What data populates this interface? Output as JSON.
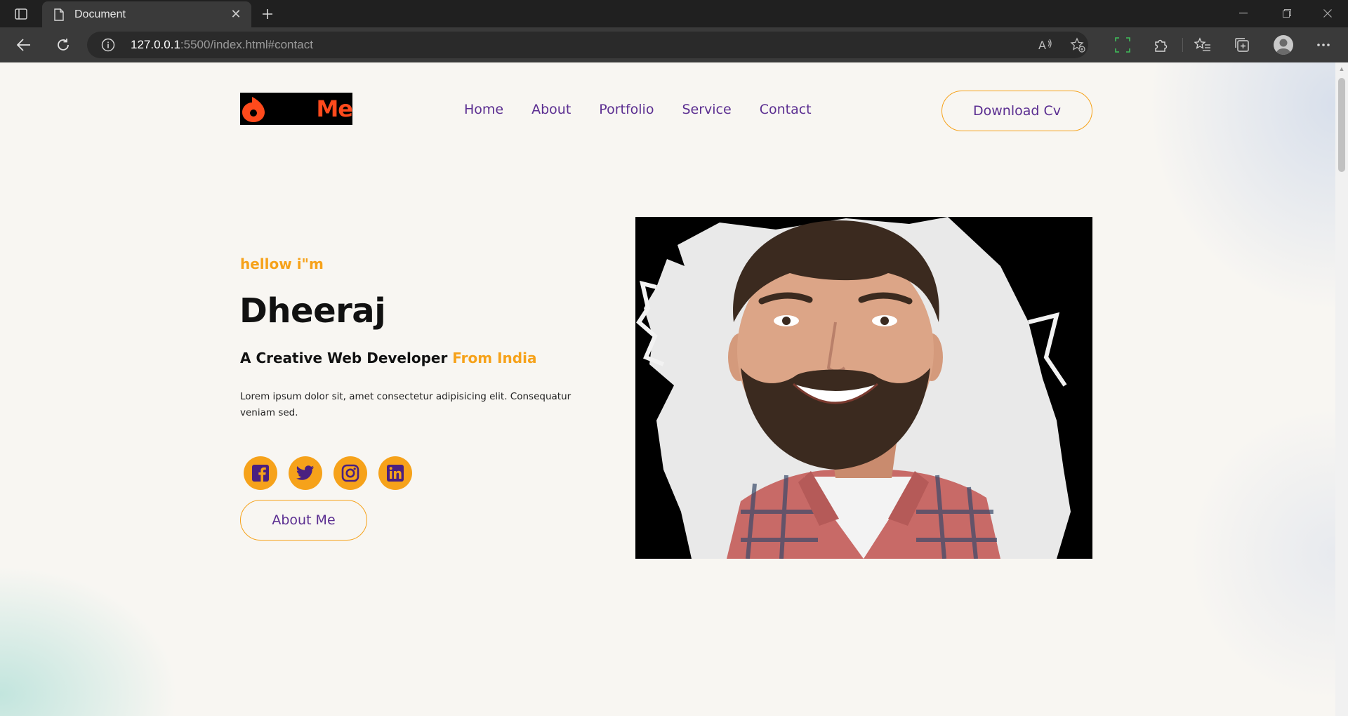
{
  "browser": {
    "tab_title": "Document",
    "url_host": "127.0.0.1",
    "url_rest": ":5500/index.html#contact"
  },
  "site": {
    "logo_text": "Me",
    "nav": [
      "Home",
      "About",
      "Portfolio",
      "Service",
      "Contact"
    ],
    "cv_button": "Download Cv",
    "greeting": "hellow i\"m",
    "name": "Dheeraj",
    "tagline_main": "A Creative Web Developer",
    "tagline_accent": "From India",
    "bio": "Lorem ipsum dolor sit, amet consectetur adipisicing elit. Consequatur veniam sed.",
    "about_button": "About Me",
    "socials": [
      "facebook-icon",
      "twitter-icon",
      "instagram-icon",
      "linkedin-icon"
    ]
  },
  "colors": {
    "accent": "#f6a21a",
    "nav_text": "#5b2e91",
    "logo": "#ff4a1c",
    "page_bg": "#f8f6f2"
  }
}
